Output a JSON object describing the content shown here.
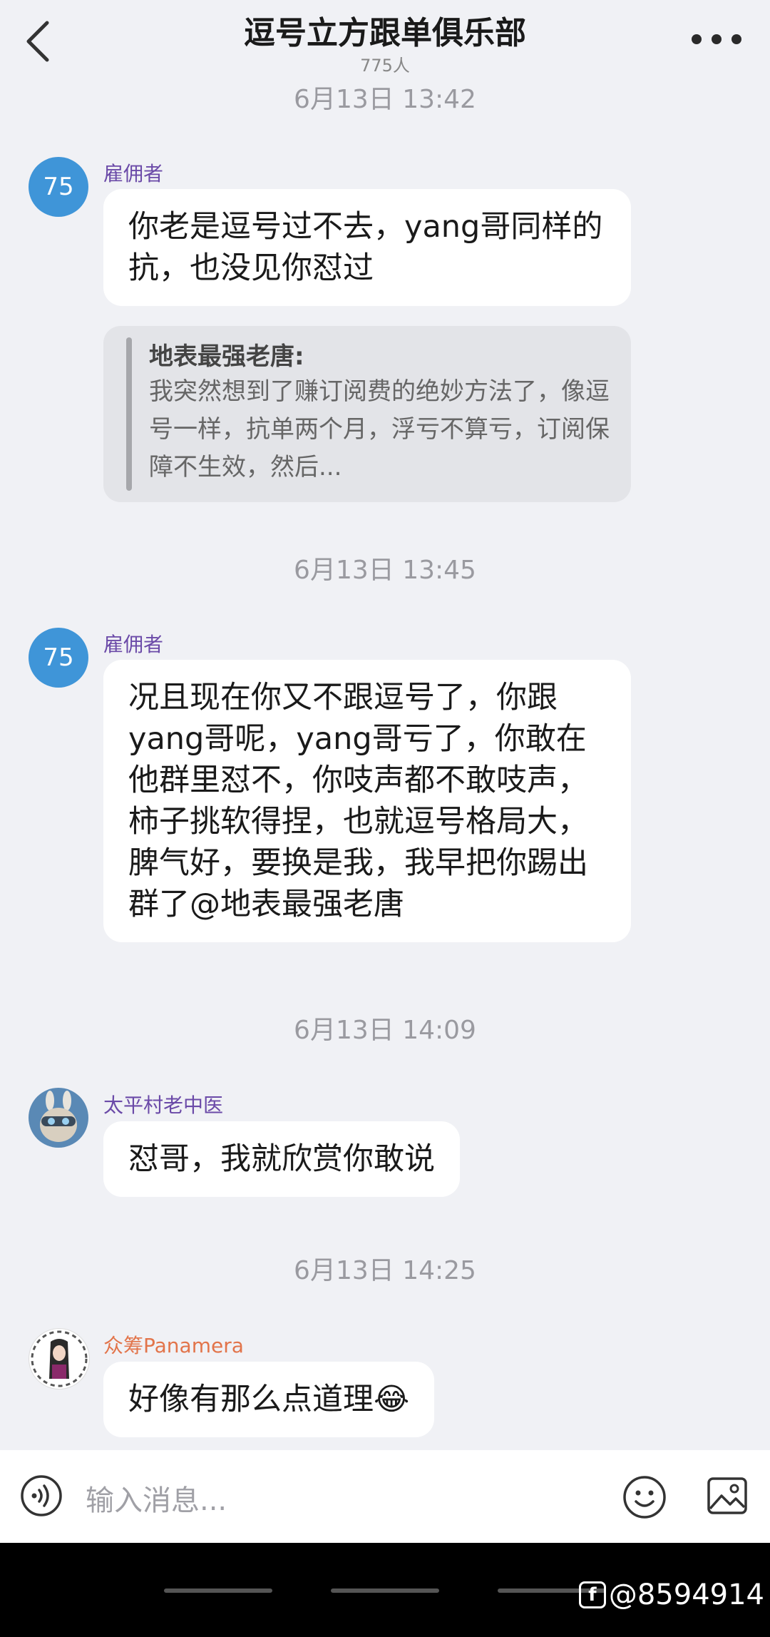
{
  "header": {
    "title": "逗号立方跟单俱乐部",
    "member_count": "775人"
  },
  "messages": [
    {
      "time": "6月13日 13:42"
    },
    {
      "avatar_text": "75",
      "sender": "雇佣者",
      "text": "你老是逗号过不去，yang哥同样的抗，也没见你怼过",
      "quote": {
        "name": "地表最强老唐:",
        "text": "我突然想到了赚订阅费的绝妙方法了，像逗号一样，抗单两个月，浮亏不算亏，订阅保障不生效，然后..."
      }
    },
    {
      "time": "6月13日 13:45"
    },
    {
      "avatar_text": "75",
      "sender": "雇佣者",
      "text": "况且现在你又不跟逗号了，你跟yang哥呢，yang哥亏了，你敢在他群里怼不，你吱声都不敢吱声，柿子挑软得捏，也就逗号格局大，脾气好，要换是我，我早把你踢出群了@地表最强老唐"
    },
    {
      "time": "6月13日 14:09"
    },
    {
      "sender": "太平村老中医",
      "text": "怼哥，我就欣赏你敢说"
    },
    {
      "time": "6月13日 14:25"
    },
    {
      "sender": "众筹Panamera",
      "text": "好像有那么点道理😂"
    }
  ],
  "input": {
    "placeholder": "输入消息..."
  },
  "watermark": {
    "logo": "f",
    "text": "@8594914"
  },
  "colors": {
    "background": "#f0f1f5",
    "bubble": "#ffffff",
    "avatar_blue": "#3f95d8",
    "sender_purple": "#6b4aa8",
    "sender_orange": "#e2744a"
  }
}
